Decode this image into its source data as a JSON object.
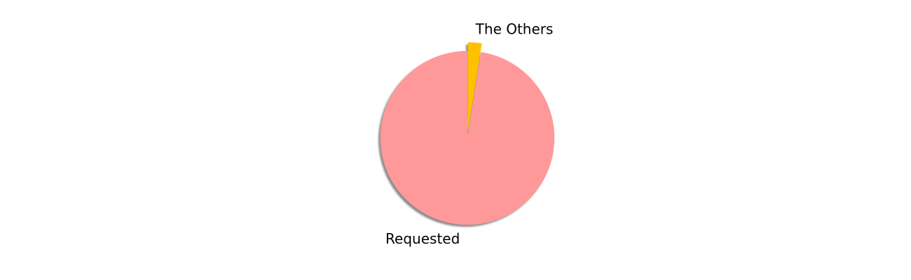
{
  "chart_data": {
    "type": "pie",
    "labels": [
      "Requested",
      "The Others"
    ],
    "values": [
      97.5,
      2.5
    ],
    "colors": [
      "#ff9999",
      "#ffc000"
    ],
    "explode": [
      0,
      0.1
    ],
    "shadow": true,
    "start_angle_degrees": 90,
    "direction": "counterclockwise"
  }
}
